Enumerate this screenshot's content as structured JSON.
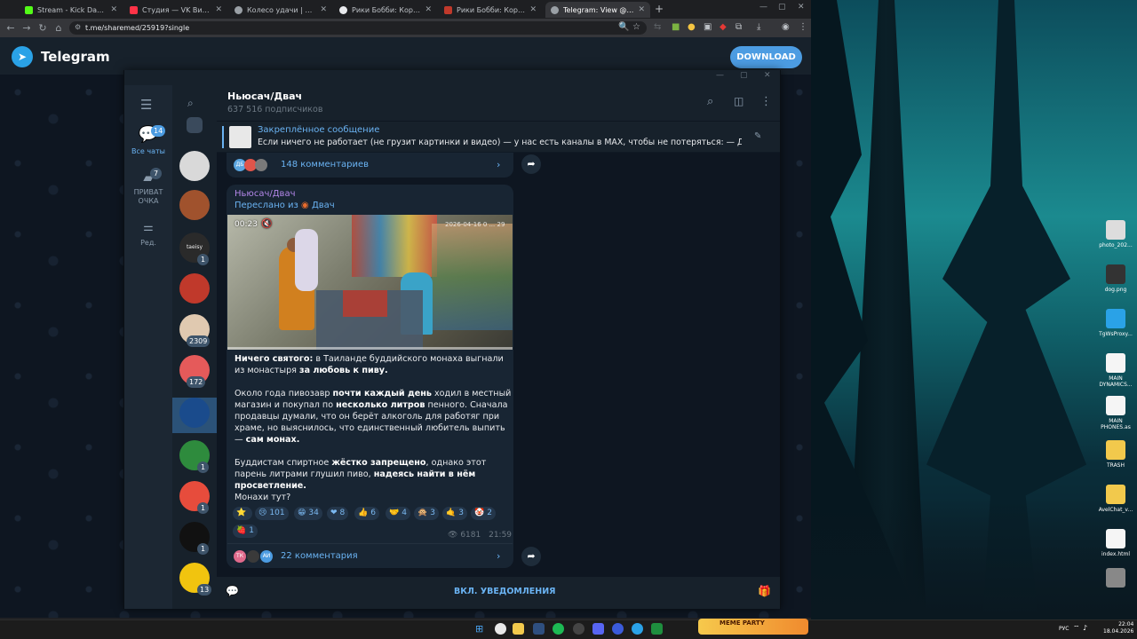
{
  "browser": {
    "tabs": [
      {
        "label": "Stream - Kick Dashboard",
        "color": "#53fc18"
      },
      {
        "label": "Студия — VK Видео Live",
        "color": "#ff3347"
      },
      {
        "label": "Колесо удачи | Определите ли",
        "color": "#9aa0a6"
      },
      {
        "label": "Рики Бобби: Король дороги (",
        "color": "#e8eaed"
      },
      {
        "label": "Рики Бобби: Король дороги (",
        "color": "#c0392b"
      },
      {
        "label": "Telegram: View @sharemed",
        "color": "#9aa0a6"
      }
    ],
    "new_tab": "+",
    "url": "t.me/sharemed/25919?single"
  },
  "telegram_web": {
    "logo_icon": "telegram-plane-icon",
    "title": "Telegram",
    "download_label": "DOWNLOAD"
  },
  "sidebar": {
    "folders": [
      {
        "label": "Все чаты",
        "badge": "14",
        "icon": "chat-bubbles-icon"
      },
      {
        "label": "ПРИВАТ ОЧКА",
        "badge": "7",
        "icon": "folder-icon"
      },
      {
        "label": "Ред.",
        "badge": "",
        "icon": "sliders-icon"
      }
    ]
  },
  "chat_list": [
    {
      "name": "archive",
      "badge": "",
      "color": "#3a4a5c"
    },
    {
      "name": "chat-2",
      "badge": "",
      "color": "#d9d9d9"
    },
    {
      "name": "chat-3",
      "badge": "",
      "color": "#a0522d"
    },
    {
      "name": "chat-4",
      "badge": "1",
      "color": "#2a2a2a",
      "text": "taeisy"
    },
    {
      "name": "chat-5",
      "badge": "",
      "color": "#c0392b"
    },
    {
      "name": "chat-6",
      "badge": "2309",
      "color": "#e0c9b0"
    },
    {
      "name": "chat-7",
      "badge": "172",
      "color": "#e55a5a"
    },
    {
      "name": "chat-8",
      "badge": "",
      "color": "#1a4b8c"
    },
    {
      "name": "chat-9",
      "badge": "1",
      "color": "#2e8b3d"
    },
    {
      "name": "chat-10",
      "badge": "1",
      "color": "#e74c3c"
    },
    {
      "name": "chat-11",
      "badge": "1",
      "color": "#111"
    },
    {
      "name": "chat-12",
      "badge": "13",
      "color": "#f1c40f"
    }
  ],
  "channel": {
    "name": "Ньюсач/Двач",
    "subscribers": "637 516 подписчиков"
  },
  "pinned": {
    "title": "Закреплённое сообщение",
    "text": "Если ничего не работает (не грузит картинки и видео) — у нас есть каналы в MAX, чтобы не потеряться:  — Двач; ..."
  },
  "prev_message": {
    "comments": "148 комментариев"
  },
  "message": {
    "sender": "Ньюсач/Двач",
    "forwarded": "Переслано из",
    "forwarded_from": "Двач",
    "video_time": "00:23",
    "video_stamp": "2026-04-16 0 ... 29",
    "p1_b1": "Ничего святого:",
    "p1_t1": " в Таиланде буддийского монаха выгнали из монастыря ",
    "p1_b2": "за любовь к пиву.",
    "p2_t1": "Около года пивозавр ",
    "p2_b1": "почти каждый день",
    "p2_t2": " ходил в местный магазин и покупал по ",
    "p2_b2": "несколько литров",
    "p2_t3": " пенного. Сначала продавцы думали, что он берёт алкоголь для работяг при храме, но выяснилось, что единственный любитель выпить — ",
    "p2_b3": "сам монах.",
    "p3_t1": "Буддистам спиртное ",
    "p3_b1": "жёстко запрещено",
    "p3_t2": ", однако этот парень литрами глушил пиво, ",
    "p3_b2": "надеясь найти в нём просветление.",
    "p4": "Монахи тут?",
    "reactions": [
      {
        "emoji": "⭐",
        "count": ""
      },
      {
        "emoji": "😢",
        "count": "101"
      },
      {
        "emoji": "😁",
        "count": "34"
      },
      {
        "emoji": "❤",
        "count": "8"
      },
      {
        "emoji": "👍",
        "count": "6"
      },
      {
        "emoji": "🤝",
        "count": "4"
      },
      {
        "emoji": "🙊",
        "count": "3"
      },
      {
        "emoji": "🤙",
        "count": "3"
      },
      {
        "emoji": "🤡",
        "count": "2"
      },
      {
        "emoji": "🍓",
        "count": "1"
      }
    ],
    "views": "6181",
    "time": "21:59",
    "comments": "22 комментария",
    "commenters": [
      "ТК",
      "",
      "АИ"
    ]
  },
  "bottom": {
    "notify_label": "ВКЛ. УВЕДОМЛЕНИЯ"
  },
  "desktop_icons": [
    {
      "label": "photo_202...",
      "color": "#ddd"
    },
    {
      "label": "dog.png",
      "color": "#333"
    },
    {
      "label": "TgWsProxy...",
      "color": "#2aa2e7"
    },
    {
      "label": "MAIN DYNAMICS...",
      "color": "#f5f5f5"
    },
    {
      "label": "MAIN PHONES.as",
      "color": "#f5f5f5"
    },
    {
      "label": "TRASH",
      "color": "#f2c94c"
    },
    {
      "label": "AvelChat_v...",
      "color": "#f2c94c"
    },
    {
      "label": "index.html",
      "color": "#f5f5f5"
    },
    {
      "label": "",
      "color": "#888"
    }
  ],
  "taskbar": {
    "widget": "MEME PARTY",
    "lang": "РУС",
    "time": "22:04",
    "date": "18.04.2026"
  }
}
